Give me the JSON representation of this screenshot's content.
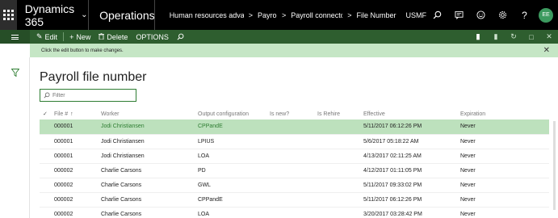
{
  "topbar": {
    "brand": "Dynamics 365",
    "brand_chevron": "⌵",
    "module": "Operations",
    "breadcrumbs": [
      "Human resources advanc",
      "Payrol",
      "Payroll connectc",
      "File Number"
    ],
    "company": "USMF",
    "avatar_initials": "EE"
  },
  "actions": {
    "edit": "Edit",
    "new": "New",
    "delete": "Delete",
    "options": "OPTIONS"
  },
  "message": {
    "text": "Click the edit button to make changes."
  },
  "page": {
    "title": "Payroll file number"
  },
  "filter": {
    "placeholder": "Filter"
  },
  "grid": {
    "headers": {
      "file": "File #",
      "worker": "Worker",
      "output": "Output configuration",
      "is_new": "Is new?",
      "is_rehire": "Is Rehire",
      "effective": "Effective",
      "expiration": "Expiration"
    },
    "rows": [
      {
        "file": "000001",
        "worker": "Jodi Christiansen",
        "output": "CPPandE",
        "effective": "5/11/2017 06:12:26 PM",
        "expiration": "Never"
      },
      {
        "file": "000001",
        "worker": "Jodi Christiansen",
        "output": "LPIUS",
        "effective": "5/6/2017 05:18:22 AM",
        "expiration": "Never"
      },
      {
        "file": "000001",
        "worker": "Jodi Christiansen",
        "output": "LOA",
        "effective": "4/13/2017 02:11:25 AM",
        "expiration": "Never"
      },
      {
        "file": "000002",
        "worker": "Charlie Carsons",
        "output": "PD",
        "effective": "4/12/2017 01:11:05 PM",
        "expiration": "Never"
      },
      {
        "file": "000002",
        "worker": "Charlie Carsons",
        "output": "GWL",
        "effective": "5/11/2017 09:33:02 PM",
        "expiration": "Never"
      },
      {
        "file": "000002",
        "worker": "Charlie Carsons",
        "output": "CPPandE",
        "effective": "5/11/2017 06:12:26 PM",
        "expiration": "Never"
      },
      {
        "file": "000002",
        "worker": "Charlie Carsons",
        "output": "LOA",
        "effective": "3/20/2017 03:28:42 PM",
        "expiration": "Never"
      }
    ]
  },
  "colors": {
    "topbar": "#000000",
    "actionbar": "#2e5e2f",
    "messagebar": "#c5e6c5",
    "selected_row": "#bde1bd",
    "accent": "#2e7d32"
  }
}
